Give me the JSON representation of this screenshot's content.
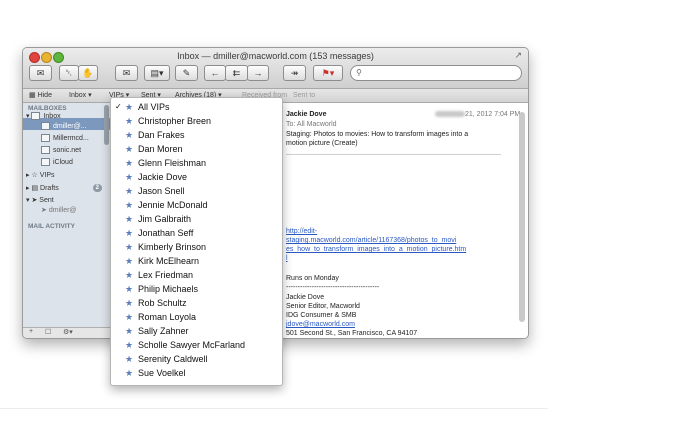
{
  "window": {
    "title": "Inbox — dmiller@macworld.com (153 messages)"
  },
  "toolbar": {
    "buttons": [
      {
        "name": "get-mail-button",
        "glyph": "✉"
      },
      {
        "name": "delete-button",
        "glyph": "␡"
      },
      {
        "name": "junk-button",
        "glyph": "✋"
      },
      {
        "name": "new-message-button",
        "glyph": "✉"
      },
      {
        "name": "archive-button",
        "glyph": "▤▾"
      },
      {
        "name": "compose-button",
        "glyph": "✎"
      },
      {
        "name": "reply-button",
        "glyph": "←"
      },
      {
        "name": "reply-all-button",
        "glyph": "⇇"
      },
      {
        "name": "forward-button",
        "glyph": "→"
      },
      {
        "name": "redirect-button",
        "glyph": "↠"
      },
      {
        "name": "flag-button",
        "glyph": "⚑▾"
      }
    ],
    "search_icon": "⚲"
  },
  "favorites": {
    "hide": "Hide",
    "inbox": "Inbox ▾",
    "vips": "VIPs ▾",
    "sent": "Sent ▾",
    "archives": "Archives (18) ▾",
    "received_from": "Received from",
    "sent_to": "Sent to"
  },
  "sidebar": {
    "mailboxes": "MAILBOXES",
    "inbox": "Inbox",
    "accounts": [
      "dmiller@...",
      "Millermcd...",
      "sonic.net",
      "iCloud"
    ],
    "vips": "VIPs",
    "drafts": "Drafts",
    "drafts_count": "2",
    "sent": "Sent",
    "sent_sub": "dmiller@",
    "mail_activity": "MAIL ACTIVITY",
    "bottom_add": "+",
    "bottom_mid": "☐",
    "bottom_gear": "⚙▾"
  },
  "message": {
    "from": "Jackie Dove",
    "date": "21, 2012  7:04 PM",
    "to": "To:  All Macworld",
    "subject_1": "Staging: Photos to movies: How to transform images into a",
    "subject_2": "motion picture (Create)",
    "link_1": "http://edit-",
    "link_2": "staging.macworld.com/article/1167368/photos_to_movi",
    "link_3": "es_how_to_transform_images_into_a_motion_picture.htm",
    "link_4": "l",
    "runs": "Runs on Monday",
    "dashes": "----------------------------------------",
    "sig_name": "Jackie Dove",
    "sig_title": "Senior Editor, Macworld",
    "sig_org": "IDG Consumer & SMB",
    "sig_email": "jdove@macworld.com",
    "sig_address": "501 Second St., San Francisco, CA 94107"
  },
  "vip_menu": {
    "items": [
      {
        "label": "All VIPs",
        "checked": "✓"
      },
      {
        "label": "Christopher Breen",
        "checked": ""
      },
      {
        "label": "Dan Frakes",
        "checked": ""
      },
      {
        "label": "Dan Moren",
        "checked": ""
      },
      {
        "label": "Glenn Fleishman",
        "checked": ""
      },
      {
        "label": "Jackie Dove",
        "checked": ""
      },
      {
        "label": "Jason Snell",
        "checked": ""
      },
      {
        "label": "Jennie McDonald",
        "checked": ""
      },
      {
        "label": "Jim Galbraith",
        "checked": ""
      },
      {
        "label": "Jonathan Seff",
        "checked": ""
      },
      {
        "label": "Kimberly Brinson",
        "checked": ""
      },
      {
        "label": "Kirk McElhearn",
        "checked": ""
      },
      {
        "label": "Lex Friedman",
        "checked": ""
      },
      {
        "label": "Philip Michaels",
        "checked": ""
      },
      {
        "label": "Rob Schultz",
        "checked": ""
      },
      {
        "label": "Roman Loyola",
        "checked": ""
      },
      {
        "label": "Sally Zahner",
        "checked": ""
      },
      {
        "label": "Scholle Sawyer McFarland",
        "checked": ""
      },
      {
        "label": "Serenity Caldwell",
        "checked": ""
      },
      {
        "label": "Sue Voelkel",
        "checked": ""
      }
    ],
    "star": "★"
  },
  "colors": {
    "link": "#2a59c4",
    "vip_star": "#5b7fb8",
    "sidebar_selection": "#7c98bd"
  }
}
